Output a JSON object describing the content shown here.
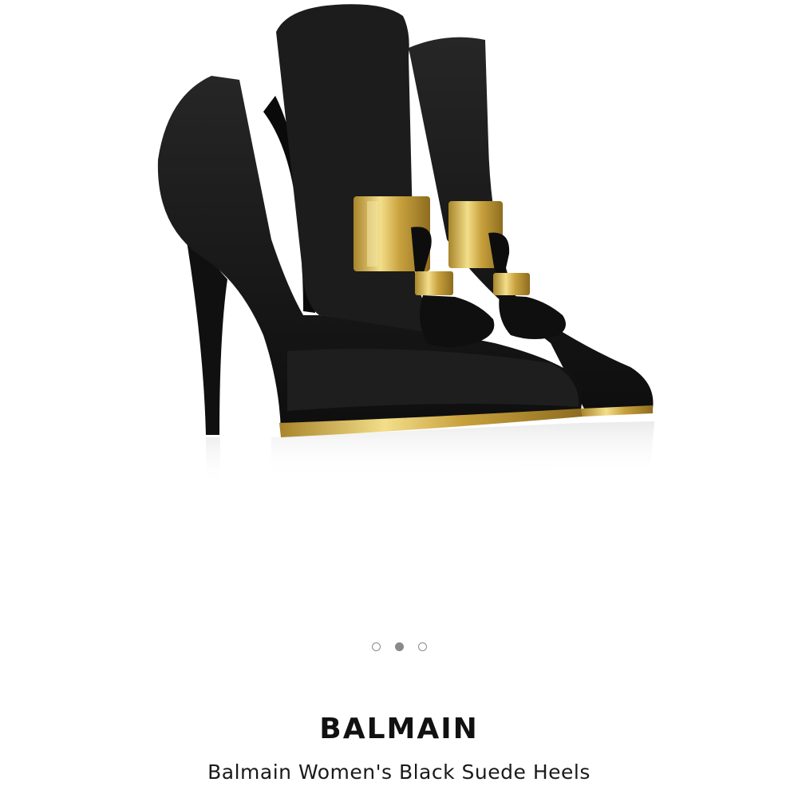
{
  "product": {
    "brand": "BALMAIN",
    "name": "Balmain Women's Black Suede Heels",
    "image_alt": "Balmain Women's Black Suede Heels"
  },
  "carousel": {
    "slide_count": 3,
    "active_index": 1
  },
  "colors": {
    "suede": "#161616",
    "gold": "#d4b04a",
    "dot": "#8a8a8a",
    "background": "#ffffff"
  }
}
